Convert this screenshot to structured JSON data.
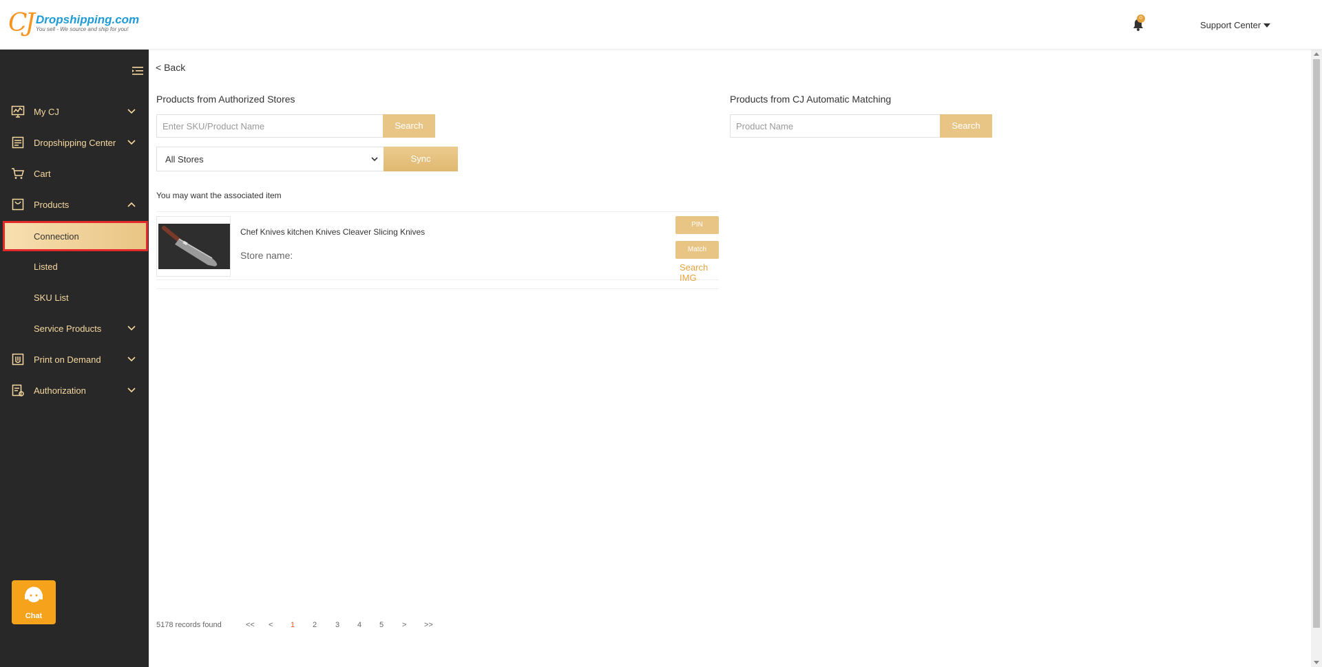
{
  "header": {
    "logo_mark": "CJ",
    "logo_title": "Dropshipping.com",
    "logo_tagline": "You sell - We source and ship for you!",
    "notification_count": "0",
    "support_label": "Support Center"
  },
  "sidebar": {
    "items": [
      {
        "label": "My CJ",
        "icon": "monitor-chart-icon",
        "expandable": true
      },
      {
        "label": "Dropshipping Center",
        "icon": "clipboard-icon",
        "expandable": true
      },
      {
        "label": "Cart",
        "icon": "cart-icon",
        "expandable": false
      },
      {
        "label": "Products",
        "icon": "bag-icon",
        "expandable": true,
        "expanded": true
      },
      {
        "label": "Connection",
        "sub": true,
        "active": true
      },
      {
        "label": "Listed",
        "sub": true
      },
      {
        "label": "SKU List",
        "sub": true
      },
      {
        "label": "Service Products",
        "sub": true,
        "expandable": true
      },
      {
        "label": "Print on Demand",
        "icon": "print-icon",
        "expandable": true
      },
      {
        "label": "Authorization",
        "icon": "authorization-icon",
        "expandable": true
      }
    ],
    "chat_label": "Chat"
  },
  "main": {
    "back_label": "< Back",
    "left_title": "Products from Authorized Stores",
    "left_search_placeholder": "Enter SKU/Product Name",
    "search_label": "Search",
    "store_select_value": "All Stores",
    "sync_label": "Sync",
    "right_title": "Products from CJ Automatic Matching",
    "right_search_placeholder": "Product Name",
    "associated_label": "You may want the associated item",
    "product": {
      "name": "Chef Knives kitchen Knives Cleaver Slicing Knives",
      "store_label": "Store name:",
      "pin_label": "PIN",
      "match_label": "Match",
      "search_img_label": "Search IMG"
    }
  },
  "pagination": {
    "records": "5178 records found",
    "first": "<<",
    "prev": "<",
    "pages": [
      "1",
      "2",
      "3",
      "4",
      "5"
    ],
    "current": "1",
    "next": ">",
    "last": ">>"
  },
  "colors": {
    "accent_gold": "#e9c585",
    "sidebar_bg": "#282828",
    "sidebar_text": "#f7d9a0",
    "active_outline": "#e22a2a",
    "link_orange": "#e6a23c"
  }
}
